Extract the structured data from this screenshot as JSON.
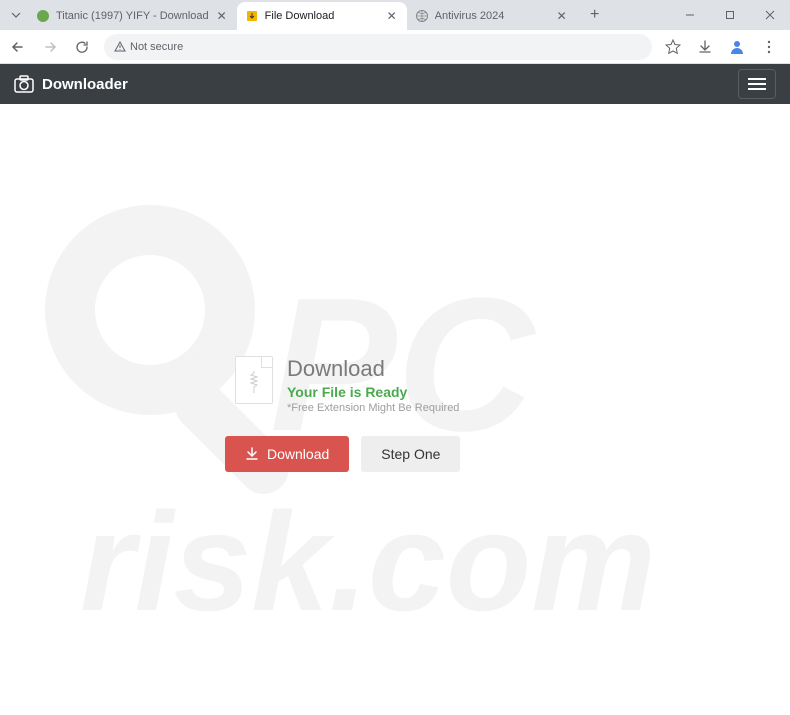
{
  "tabs": [
    {
      "title": "Titanic (1997) YIFY - Download"
    },
    {
      "title": "File Download"
    },
    {
      "title": "Antivirus 2024"
    }
  ],
  "address": {
    "not_secure": "Not secure"
  },
  "nav": {
    "brand": "Downloader"
  },
  "panel": {
    "title": "Download",
    "ready": "Your File is Ready",
    "note": "*Free Extension Might Be Required",
    "download_btn": "Download",
    "step_btn": "Step One"
  }
}
